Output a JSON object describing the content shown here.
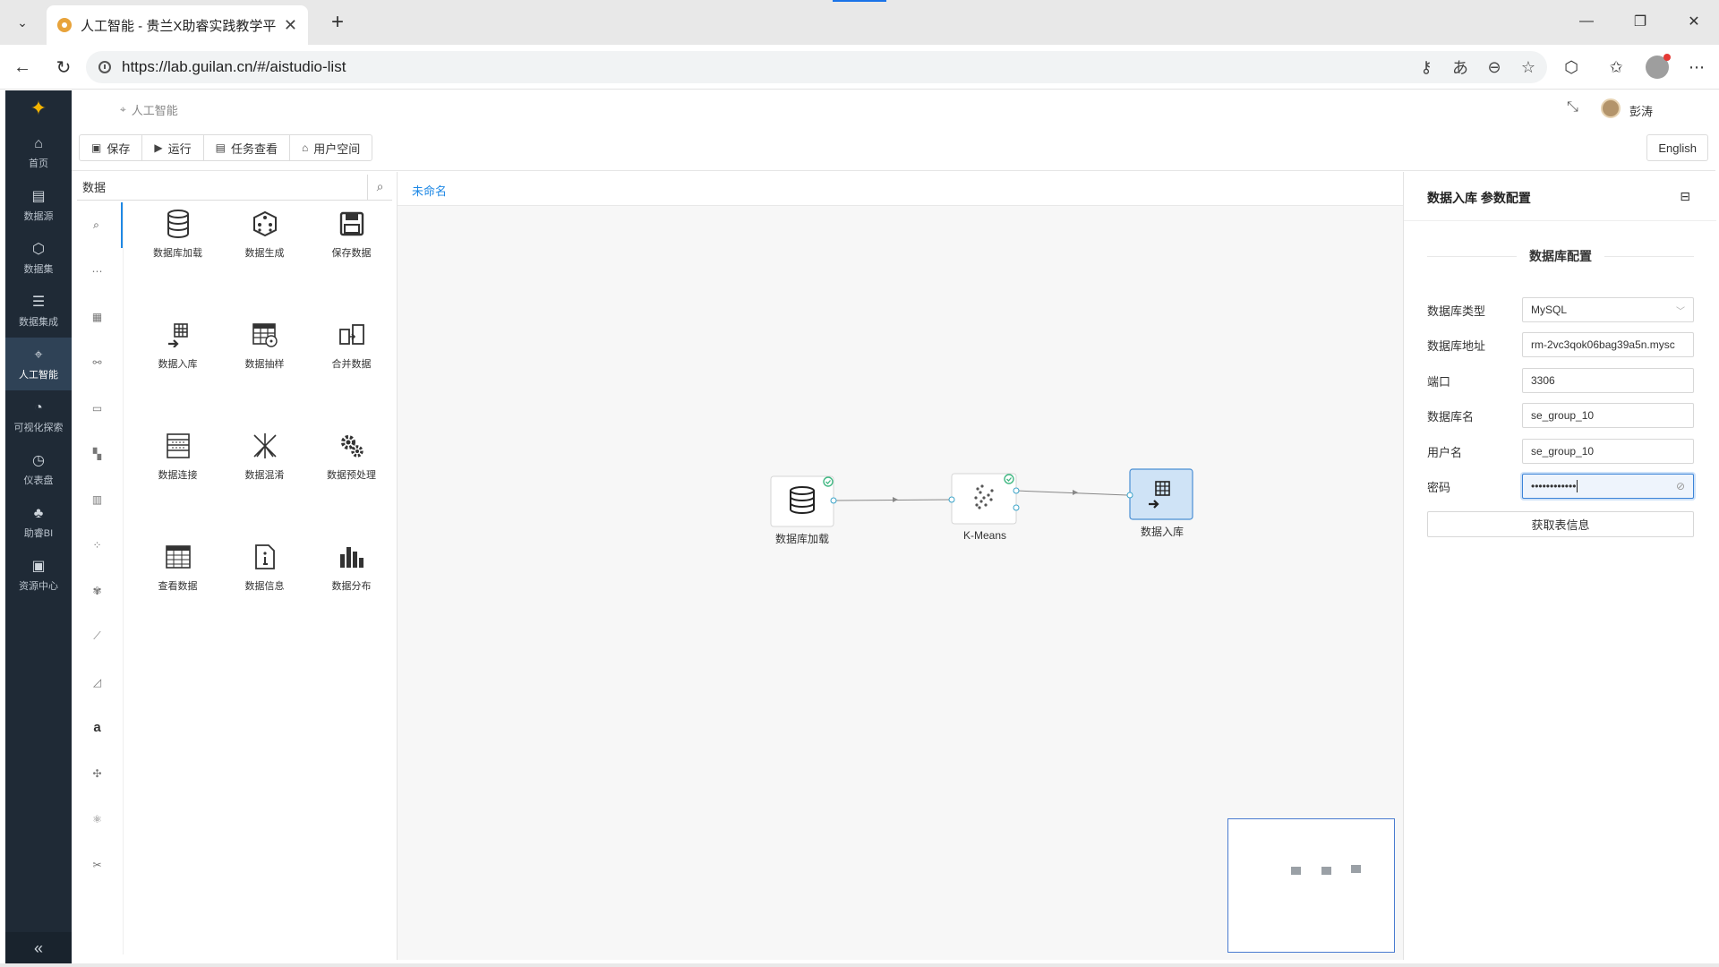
{
  "browser": {
    "tab_title": "人工智能 - 贵兰X助睿实践教学平台",
    "url": "https://lab.guilan.cn/#/aistudio-list"
  },
  "app": {
    "breadcrumb": "人工智能",
    "user_name": "彭涛",
    "sidebar": [
      {
        "label": "首页",
        "icon": "home-icon",
        "glyph": "⌂"
      },
      {
        "label": "数据源",
        "icon": "datasource-icon",
        "glyph": "▤"
      },
      {
        "label": "数据集",
        "icon": "dataset-icon",
        "glyph": "⬡"
      },
      {
        "label": "数据集成",
        "icon": "data-integration-icon",
        "glyph": "☰"
      },
      {
        "label": "人工智能",
        "icon": "ai-icon",
        "glyph": "⌖"
      },
      {
        "label": "可视化探索",
        "icon": "visual-explore-icon",
        "glyph": "◔"
      },
      {
        "label": "仪表盘",
        "icon": "dashboard-icon",
        "glyph": "◷"
      },
      {
        "label": "助睿BI",
        "icon": "bi-icon",
        "glyph": "♣"
      },
      {
        "label": "资源中心",
        "icon": "resource-center-icon",
        "glyph": "▣"
      }
    ],
    "toolbar": {
      "save": "保存",
      "run": "运行",
      "tasks": "任务查看",
      "user_space": "用户空间",
      "language": "English"
    },
    "component_panel": {
      "search_value": "数据",
      "category_icons": [
        "search-icon",
        "ellipsis-icon",
        "table-icon",
        "link-icon",
        "card-icon",
        "grid-icon",
        "bar-icon",
        "scatter-icon",
        "cluster-icon",
        "line-chart-icon",
        "area-chart-icon",
        "text-icon",
        "network-icon",
        "atom-icon",
        "tools-icon"
      ],
      "items": [
        {
          "label": "数据库加载",
          "icon": "database-icon"
        },
        {
          "label": "数据生成",
          "icon": "dice-icon"
        },
        {
          "label": "保存数据",
          "icon": "floppy-icon"
        },
        {
          "label": "数据入库",
          "icon": "grid-arrow-icon"
        },
        {
          "label": "数据抽样",
          "icon": "table-sample-icon"
        },
        {
          "label": "合并数据",
          "icon": "merge-icon"
        },
        {
          "label": "数据连接",
          "icon": "join-icon"
        },
        {
          "label": "数据混淆",
          "icon": "shuffle-icon"
        },
        {
          "label": "数据预处理",
          "icon": "gears-icon"
        },
        {
          "label": "查看数据",
          "icon": "table-view-icon"
        },
        {
          "label": "数据信息",
          "icon": "info-doc-icon"
        },
        {
          "label": "数据分布",
          "icon": "bar-distribution-icon"
        }
      ]
    },
    "canvas": {
      "tab": "未命名",
      "nodes": [
        {
          "label": "数据库加载",
          "icon": "database-icon",
          "status": "success"
        },
        {
          "label": "K-Means",
          "icon": "kmeans-icon",
          "status": "success"
        },
        {
          "label": "数据入库",
          "icon": "grid-arrow-icon",
          "status": "selected"
        }
      ]
    },
    "config": {
      "title": "数据入库 参数配置",
      "section": "数据库配置",
      "fields": [
        {
          "label": "数据库类型",
          "value": "MySQL"
        },
        {
          "label": "数据库地址",
          "value": "rm-2vc3qok06bag39a5n.mysc"
        },
        {
          "label": "端口",
          "value": "3306"
        },
        {
          "label": "数据库名",
          "value": "se_group_10"
        },
        {
          "label": "用户名",
          "value": "se_group_10"
        },
        {
          "label": "密码",
          "value": "••••••••••••"
        }
      ],
      "fetch_button": "获取表信息"
    }
  }
}
